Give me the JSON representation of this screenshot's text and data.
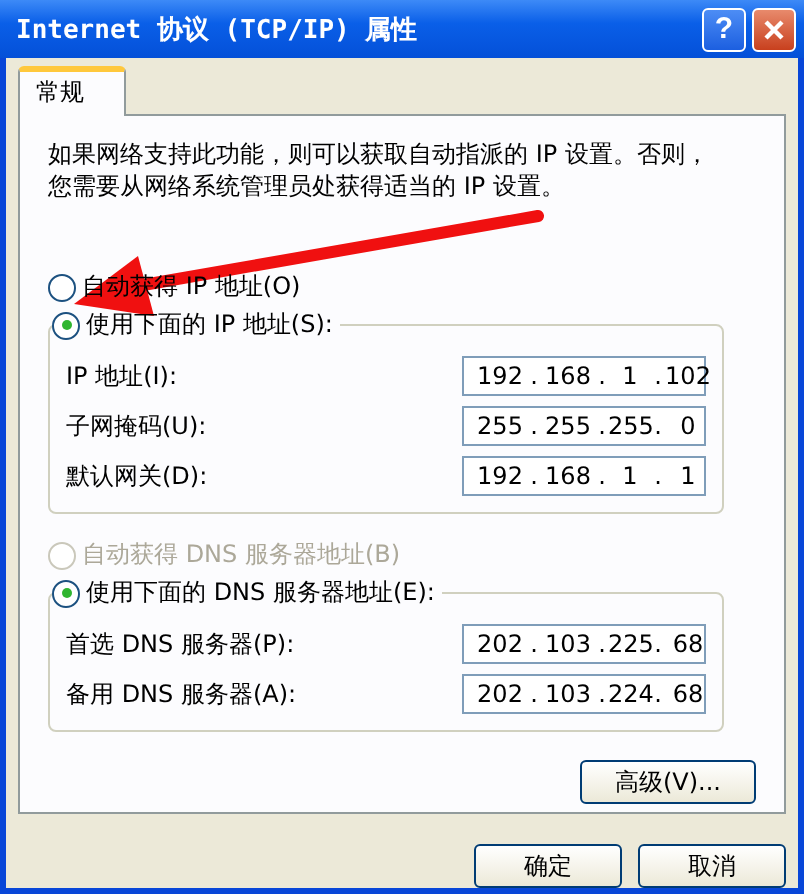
{
  "window": {
    "title": "Internet 协议 (TCP/IP) 属性",
    "help_button": "?"
  },
  "tabs": [
    {
      "label": "常规",
      "selected": true
    }
  ],
  "description": "如果网络支持此功能，则可以获取自动指派的 IP 设置。否则，您需要从网络系统管理员处获得适当的 IP 设置。",
  "ip_options": [
    {
      "label": "自动获得 IP 地址(O)",
      "selected": false,
      "disabled": false
    },
    {
      "label": "使用下面的 IP 地址(S):",
      "selected": true,
      "disabled": false
    }
  ],
  "ip_fields": [
    {
      "label": "IP 地址(I):",
      "separator": ".",
      "octets": [
        "192",
        "168",
        "1",
        "102"
      ]
    },
    {
      "label": "子网掩码(U):",
      "separator": ".",
      "octets": [
        "255",
        "255",
        "255",
        "0"
      ]
    },
    {
      "label": "默认网关(D):",
      "separator": ".",
      "octets": [
        "192",
        "168",
        "1",
        "1"
      ]
    }
  ],
  "dns_options": [
    {
      "label": "自动获得 DNS 服务器地址(B)",
      "selected": false,
      "disabled": true
    },
    {
      "label": "使用下面的 DNS 服务器地址(E):",
      "selected": true,
      "disabled": false
    }
  ],
  "dns_fields": [
    {
      "label": "首选 DNS 服务器(P):",
      "separator": ".",
      "octets": [
        "202",
        "103",
        "225",
        "68"
      ]
    },
    {
      "label": "备用 DNS 服务器(A):",
      "separator": ".",
      "octets": [
        "202",
        "103",
        "224",
        "68"
      ]
    }
  ],
  "advanced_button": "高级(V)...",
  "buttons": [
    "确定",
    "取消"
  ]
}
